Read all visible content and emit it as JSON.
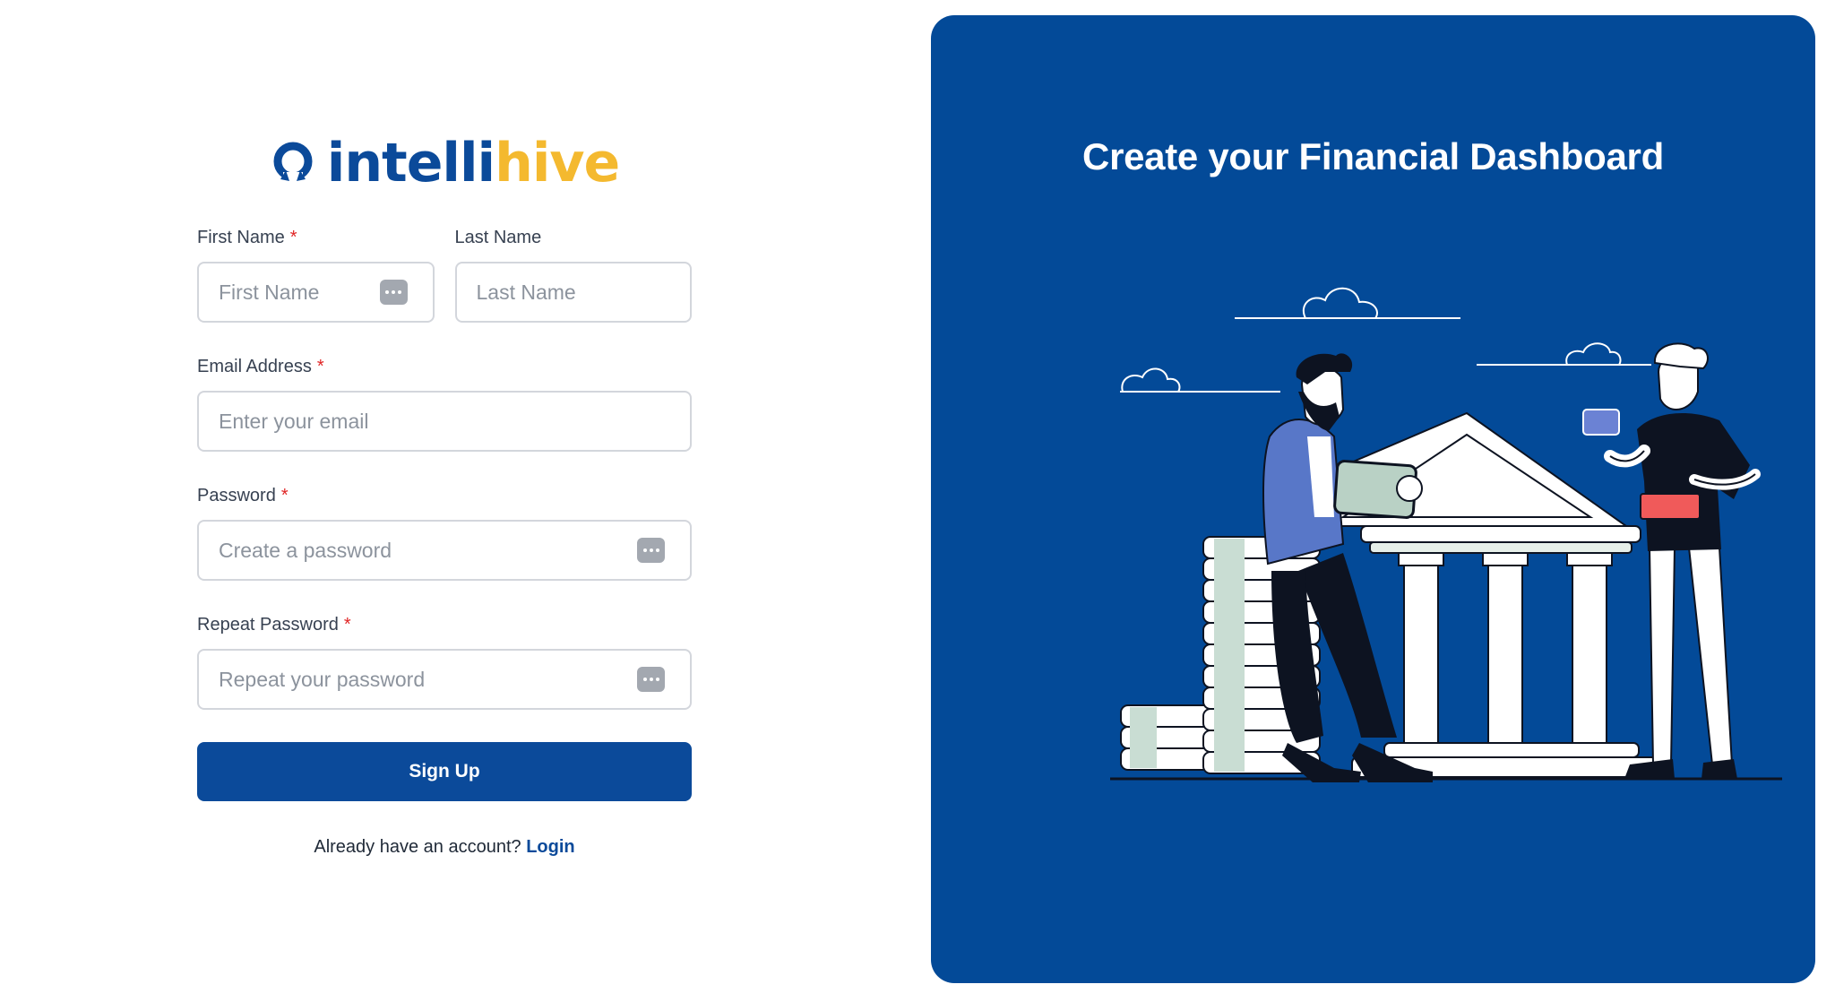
{
  "brand": {
    "logo_part1": "intelli",
    "logo_part2": "hive",
    "primary_color": "#0b4a9a",
    "accent_color": "#f4b92f"
  },
  "form": {
    "first_name": {
      "label": "First Name",
      "required_mark": "*",
      "placeholder": "First Name",
      "icon": "password-manager-icon"
    },
    "last_name": {
      "label": "Last Name",
      "placeholder": "Last Name"
    },
    "email": {
      "label": "Email Address",
      "required_mark": "*",
      "placeholder": "Enter your email"
    },
    "password": {
      "label": "Password",
      "required_mark": "*",
      "placeholder": "Create a password",
      "icon": "password-manager-icon"
    },
    "repeat_password": {
      "label": "Repeat Password",
      "required_mark": "*",
      "placeholder": "Repeat your password",
      "icon": "password-manager-icon"
    },
    "submit_label": "Sign Up",
    "login_prompt": "Already have an account?",
    "login_link": "Login"
  },
  "panel": {
    "title": "Create your Financial Dashboard",
    "background_color": "#034a98",
    "illustration": "bank-building-with-two-people-and-coin-stacks"
  }
}
